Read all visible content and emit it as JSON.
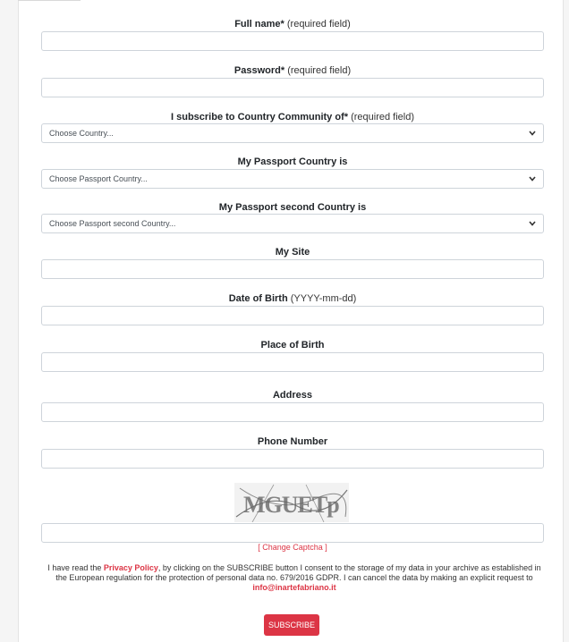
{
  "fields": {
    "full_name": {
      "label": "Full name*",
      "hint": "(required field)",
      "value": ""
    },
    "password": {
      "label": "Password*",
      "hint": "(required field)",
      "value": ""
    },
    "community": {
      "label": "I subscribe to Country Community of*",
      "hint": "(required field)",
      "selected": "Choose Country..."
    },
    "passport": {
      "label": "My Passport Country is",
      "selected": "Choose Passport Country..."
    },
    "passport2": {
      "label": "My Passport second Country is",
      "selected": "Choose Passport second Country..."
    },
    "site": {
      "label": "My Site",
      "value": ""
    },
    "dob": {
      "label": "Date of Birth",
      "hint": "(YYYY-mm-dd)",
      "value": ""
    },
    "pob": {
      "label": "Place of Birth",
      "value": ""
    },
    "address": {
      "label": "Address",
      "value": ""
    },
    "phone": {
      "label": "Phone Number",
      "value": ""
    }
  },
  "captcha": {
    "image_text": "MGUETp",
    "input_value": "",
    "change_label": "[ Change Captcha ]"
  },
  "consent": {
    "pre": "I have read the ",
    "privacy_link": "Privacy Policy",
    "mid": ", by clicking on the SUBSCRIBE button I consent to the storage of my data in your archive as established in the European regulation for the protection of personal data no. 679/2016 GDPR. I can cancel the data by making an explicit request to ",
    "email": "info@inartefabriano.it"
  },
  "submit_label": "SUBSCRIBE",
  "colors": {
    "accent": "#dc3545",
    "border": "#ced4da"
  }
}
